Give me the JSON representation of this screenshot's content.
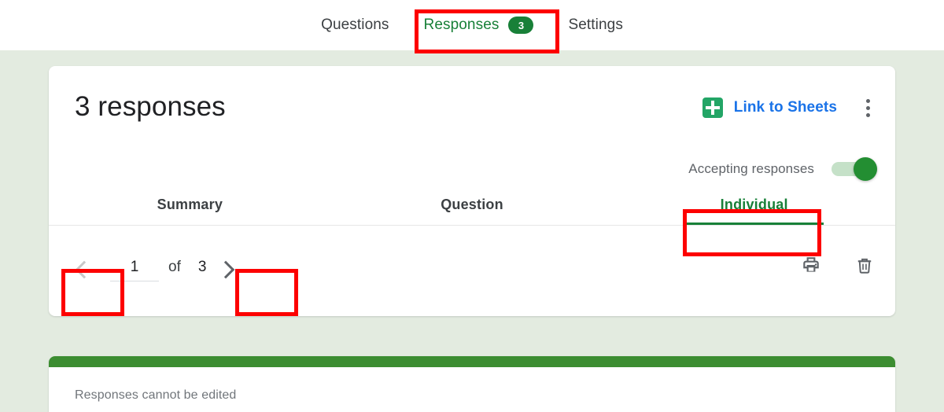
{
  "top_tabs": [
    {
      "label": "Questions",
      "active": false,
      "badge": null
    },
    {
      "label": "Responses",
      "active": true,
      "badge": "3"
    },
    {
      "label": "Settings",
      "active": false,
      "badge": null
    }
  ],
  "header": {
    "responses_title": "3 responses",
    "link_to_sheets_label": "Link to Sheets",
    "sheets_icon": "google-sheets-icon",
    "more_options_icon": "kebab-menu-icon",
    "accepting_responses_label": "Accepting responses",
    "accepting_responses_state": "on"
  },
  "sub_tabs": [
    {
      "label": "Summary",
      "active": false
    },
    {
      "label": "Question",
      "active": false
    },
    {
      "label": "Individual",
      "active": true
    }
  ],
  "pager": {
    "prev_icon": "chevron-left-icon",
    "next_icon": "chevron-right-icon",
    "prev_enabled": false,
    "next_enabled": true,
    "current_page": "1",
    "of_label": "of",
    "total_pages": "3",
    "print_icon": "print-icon",
    "delete_icon": "trash-icon"
  },
  "response_card": {
    "notice": "Responses cannot be edited"
  },
  "colors": {
    "page_background": "#e3ebe0",
    "card_background": "#ffffff",
    "accent_green": "#188038",
    "link_blue": "#1a73e8",
    "annotation_red": "#fd0000",
    "card_bar_green": "#3c8d31",
    "toggle_on_knob": "#238e32",
    "toggle_on_track": "#c5e1c8"
  },
  "annotations": [
    {
      "name": "responses-tab-highlight",
      "target": "Responses"
    },
    {
      "name": "individual-tab-highlight",
      "target": "Individual"
    },
    {
      "name": "prev-page-highlight",
      "target": "previous page"
    },
    {
      "name": "next-page-highlight",
      "target": "next page"
    }
  ]
}
